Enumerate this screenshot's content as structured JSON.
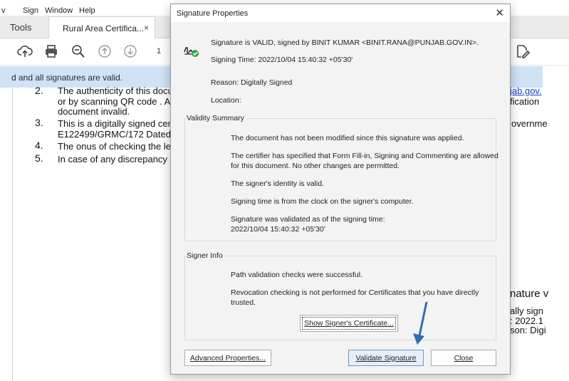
{
  "menubar": {
    "items": [
      "v",
      "Sign",
      "Window",
      "Help"
    ]
  },
  "tabs": {
    "tools_label": "Tools",
    "document_tab": "Rural Area Certifica...",
    "close_glyph": "×"
  },
  "toolbar": {
    "page_number": "1"
  },
  "signature_bar": {
    "text": "d and all signatures are valid."
  },
  "document": {
    "lines": [
      {
        "num": "2.",
        "text": "The authenticity of this docu",
        "right": "jab.gov."
      },
      {
        "text": "or by scanning QR code . Ar",
        "right": "fication"
      },
      {
        "text": "document invalid."
      },
      {
        "num": "3.",
        "text": "This is a digitally signed cert",
        "right": "overnme"
      },
      {
        "text": "E122499/GRMC/172 Dated:"
      },
      {
        "num": "4.",
        "text": "The onus of checking the leg"
      },
      {
        "num": "5.",
        "text": "In case of any discrepancy p"
      }
    ],
    "fragments": [
      "nature v",
      "ally sign",
      ": 2022.1",
      "son: Digi"
    ]
  },
  "dialog": {
    "title": "Signature Properties",
    "close_glyph": "✕",
    "status_line": "Signature is VALID, signed by BINIT KUMAR <BINIT.RANA@PUNJAB.GOV.IN>.",
    "signing_time": "Signing Time:  2022/10/04 15:40:32 +05'30'",
    "reason": "Reason:  Digitally Signed",
    "location": "Location:",
    "validity_summary": {
      "label": "Validity Summary",
      "items": [
        "The document has not been modified since this signature was applied.",
        "The certifier has specified that Form Fill-in, Signing and Commenting are allowed",
        "for this document. No other changes are permitted.",
        "The signer's identity is valid.",
        "Signing time is from the clock on the signer's computer.",
        "Signature was validated as of the signing time:",
        "2022/10/04 15:40:32 +05'30'"
      ]
    },
    "signer_info": {
      "label": "Signer Info",
      "items": [
        "Path validation checks were successful.",
        "Revocation checking is not performed for Certificates that you have directly",
        "trusted."
      ],
      "show_cert_button": "Show Signer's Certificate..."
    },
    "buttons": {
      "advanced": "Advanced Properties...",
      "validate": "Validate Signature",
      "close": "Close"
    }
  },
  "colors": {
    "accent_blue": "#2f6db3",
    "valid_green": "#2fa84f",
    "sigbar": "#cfe2f6"
  }
}
